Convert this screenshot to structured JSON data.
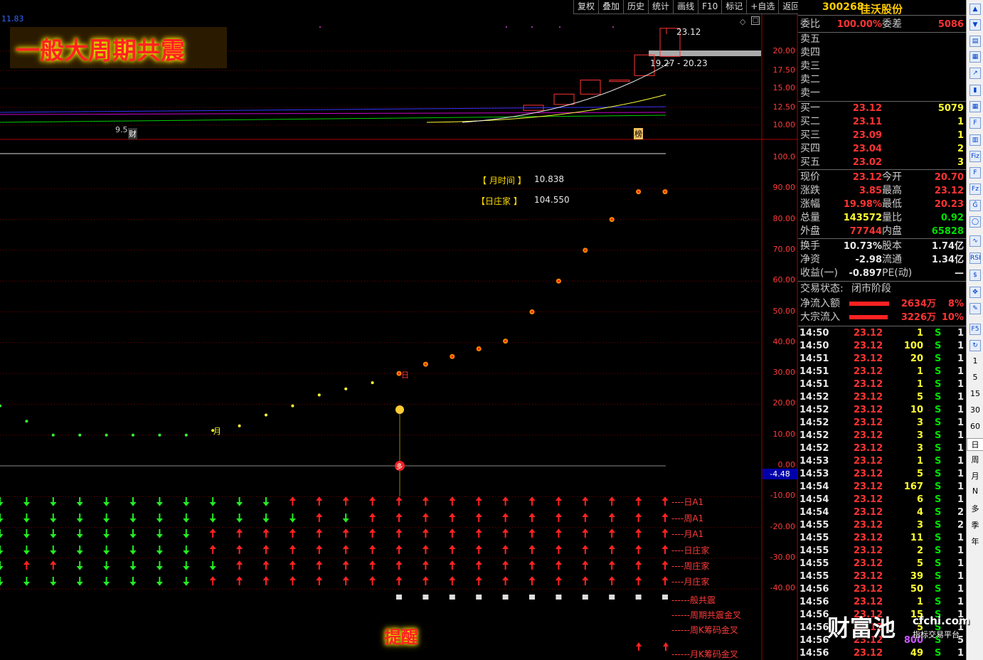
{
  "toolbar": {
    "items": [
      "复权",
      "叠加",
      "历史",
      "统计",
      "画线",
      "F10",
      "标记",
      "+自选",
      "返回"
    ]
  },
  "chart": {
    "title": "一般大周期共震",
    "reminder": "提醒",
    "cursor_price": "11.83",
    "hi_label": "23.12",
    "range_label": "19.27 - 20.23",
    "low_label": "9.5",
    "cai_tag": "财",
    "bang_tag": "榜",
    "month_tag": "月",
    "ri_tag": "日",
    "duo_tag": "多",
    "upper_axis": [
      "20.00",
      "17.50",
      "15.00",
      "12.50",
      "10.00"
    ],
    "lower_axis": [
      "100.0",
      "90.00",
      "80.00",
      "70.00",
      "60.00",
      "50.00",
      "40.00",
      "30.00",
      "20.00",
      "10.00",
      "0.00",
      "-10.00",
      "-20.00",
      "-30.00",
      "-40.00"
    ],
    "current_value": "-4.48",
    "legend1_label": "【 月时间 】",
    "legend1_value": "10.838",
    "legend2_label": "【日庄家 】",
    "legend2_value": "104.550",
    "signal_labels": [
      "----日A1",
      "----周A1",
      "----月A1",
      "----日庄家",
      "----周庄家",
      "----月庄家"
    ],
    "resonance_label": "------般共震",
    "bottom_labels": [
      "------周期共震金叉",
      "------周K筹码金叉",
      "------月K筹码金叉"
    ]
  },
  "chart_data": {
    "type": "scatter",
    "dot_values": [
      19.5,
      14.5,
      10,
      10,
      10,
      10,
      10,
      10,
      11.5,
      13,
      16.5,
      19.5,
      23,
      25,
      27,
      30,
      33,
      35.5,
      38,
      40.5,
      50,
      60,
      70,
      80,
      89,
      89
    ],
    "arrow_rows": {
      "day_a1": [
        "d",
        "d",
        "d",
        "d",
        "d",
        "d",
        "d",
        "d",
        "d",
        "d",
        "d",
        "u",
        "u",
        "u",
        "u",
        "u",
        "u",
        "u",
        "u",
        "u",
        "u",
        "u",
        "u",
        "u",
        "u",
        "u"
      ],
      "week_a1": [
        "d",
        "d",
        "d",
        "d",
        "d",
        "d",
        "d",
        "d",
        "d",
        "d",
        "d",
        "d",
        "u",
        "d",
        "u",
        "u",
        "u",
        "u",
        "u",
        "u",
        "u",
        "u",
        "u",
        "u",
        "u",
        "u"
      ],
      "month_a1": [
        "d",
        "d",
        "d",
        "d",
        "d",
        "d",
        "d",
        "d",
        "u",
        "u",
        "u",
        "u",
        "u",
        "u",
        "u",
        "u",
        "u",
        "u",
        "u",
        "u",
        "u",
        "u",
        "u",
        "u",
        "u",
        "u"
      ],
      "day_zhuang": [
        "d",
        "d",
        "d",
        "d",
        "d",
        "d",
        "d",
        "d",
        "u",
        "u",
        "u",
        "u",
        "u",
        "u",
        "u",
        "u",
        "u",
        "u",
        "u",
        "u",
        "u",
        "u",
        "u",
        "u",
        "u",
        "u"
      ],
      "week_zhuang": [
        "d",
        "u",
        "u",
        "d",
        "d",
        "d",
        "d",
        "d",
        "d",
        "u",
        "u",
        "u",
        "u",
        "u",
        "u",
        "u",
        "u",
        "u",
        "u",
        "u",
        "u",
        "u",
        "u",
        "u",
        "u",
        "u"
      ],
      "month_zhuang": [
        "d",
        "d",
        "d",
        "d",
        "d",
        "d",
        "d",
        "d",
        "u",
        "u",
        "u",
        "u",
        "u",
        "u",
        "u",
        "u",
        "u",
        "u",
        "u",
        "u",
        "u",
        "u",
        "u",
        "u",
        "u",
        "u"
      ]
    }
  },
  "quote": {
    "code": "300268",
    "name": "佳沃股份",
    "weibi_label": "委比",
    "weibi": "100.00%",
    "weicha_label": "委差",
    "weicha": "5086",
    "sells": [
      "卖五",
      "卖四",
      "卖三",
      "卖二",
      "卖一"
    ],
    "buys": [
      [
        "买一",
        "23.12",
        "5079"
      ],
      [
        "买二",
        "23.11",
        "1"
      ],
      [
        "买三",
        "23.09",
        "1"
      ],
      [
        "买四",
        "23.04",
        "2"
      ],
      [
        "买五",
        "23.02",
        "3"
      ]
    ],
    "stats": [
      [
        "现价",
        "23.12",
        "今开",
        "20.70",
        "red",
        "red"
      ],
      [
        "涨跌",
        "3.85",
        "最高",
        "23.12",
        "red",
        "red"
      ],
      [
        "涨幅",
        "19.98%",
        "最低",
        "20.23",
        "red",
        "red"
      ],
      [
        "总量",
        "143572",
        "量比",
        "0.92",
        "yel",
        "grn"
      ],
      [
        "外盘",
        "77744",
        "内盘",
        "65828",
        "red",
        "grn"
      ],
      [
        "换手",
        "10.73%",
        "股本",
        "1.74亿",
        "wht",
        "wht"
      ],
      [
        "净资",
        "-2.98",
        "流通",
        "1.34亿",
        "wht",
        "wht"
      ],
      [
        "收益(一)",
        "-0.897",
        "PE(动)",
        "—",
        "wht",
        "wht"
      ]
    ],
    "status_label": "交易状态:",
    "status": "闭市阶段",
    "flow1_label": "净流入额",
    "flow1_value": "2634万",
    "flow1_pct": "8%",
    "flow2_label": "大宗流入",
    "flow2_value": "3226万",
    "flow2_pct": "10%",
    "ticks": [
      [
        "14:50",
        "23.12",
        "1",
        "S",
        "1"
      ],
      [
        "14:50",
        "23.12",
        "100",
        "S",
        "1"
      ],
      [
        "14:51",
        "23.12",
        "20",
        "S",
        "1"
      ],
      [
        "14:51",
        "23.12",
        "1",
        "S",
        "1"
      ],
      [
        "14:51",
        "23.12",
        "1",
        "S",
        "1"
      ],
      [
        "14:52",
        "23.12",
        "5",
        "S",
        "1"
      ],
      [
        "14:52",
        "23.12",
        "10",
        "S",
        "1"
      ],
      [
        "14:52",
        "23.12",
        "3",
        "S",
        "1"
      ],
      [
        "14:52",
        "23.12",
        "3",
        "S",
        "1"
      ],
      [
        "14:52",
        "23.12",
        "3",
        "S",
        "1"
      ],
      [
        "14:53",
        "23.12",
        "1",
        "S",
        "1"
      ],
      [
        "14:53",
        "23.12",
        "5",
        "S",
        "1"
      ],
      [
        "14:54",
        "23.12",
        "167",
        "S",
        "1"
      ],
      [
        "14:54",
        "23.12",
        "6",
        "S",
        "1"
      ],
      [
        "14:54",
        "23.12",
        "4",
        "S",
        "2"
      ],
      [
        "14:55",
        "23.12",
        "3",
        "S",
        "2"
      ],
      [
        "14:55",
        "23.12",
        "11",
        "S",
        "1"
      ],
      [
        "14:55",
        "23.12",
        "2",
        "S",
        "1"
      ],
      [
        "14:55",
        "23.12",
        "5",
        "S",
        "1"
      ],
      [
        "14:55",
        "23.12",
        "39",
        "S",
        "1"
      ],
      [
        "14:56",
        "23.12",
        "50",
        "S",
        "1"
      ],
      [
        "14:56",
        "23.12",
        "1",
        "S",
        "1"
      ],
      [
        "14:56",
        "23.12",
        "15",
        "S",
        "1"
      ],
      [
        "14:56",
        "23.12",
        "5",
        "S",
        "1"
      ],
      [
        "14:56",
        "23.12",
        "800",
        "S",
        "5"
      ],
      [
        "14:56",
        "23.12",
        "49",
        "S",
        "1"
      ]
    ]
  },
  "watermark": {
    "brand": "财富池",
    "site": "cfchi.com",
    "tagline": "指标交易平台"
  },
  "sidebar": {
    "periods": [
      "1",
      "5",
      "15",
      "30",
      "60"
    ],
    "tabs": [
      "日",
      "周",
      "月",
      "N",
      "多",
      "季",
      "年"
    ]
  }
}
